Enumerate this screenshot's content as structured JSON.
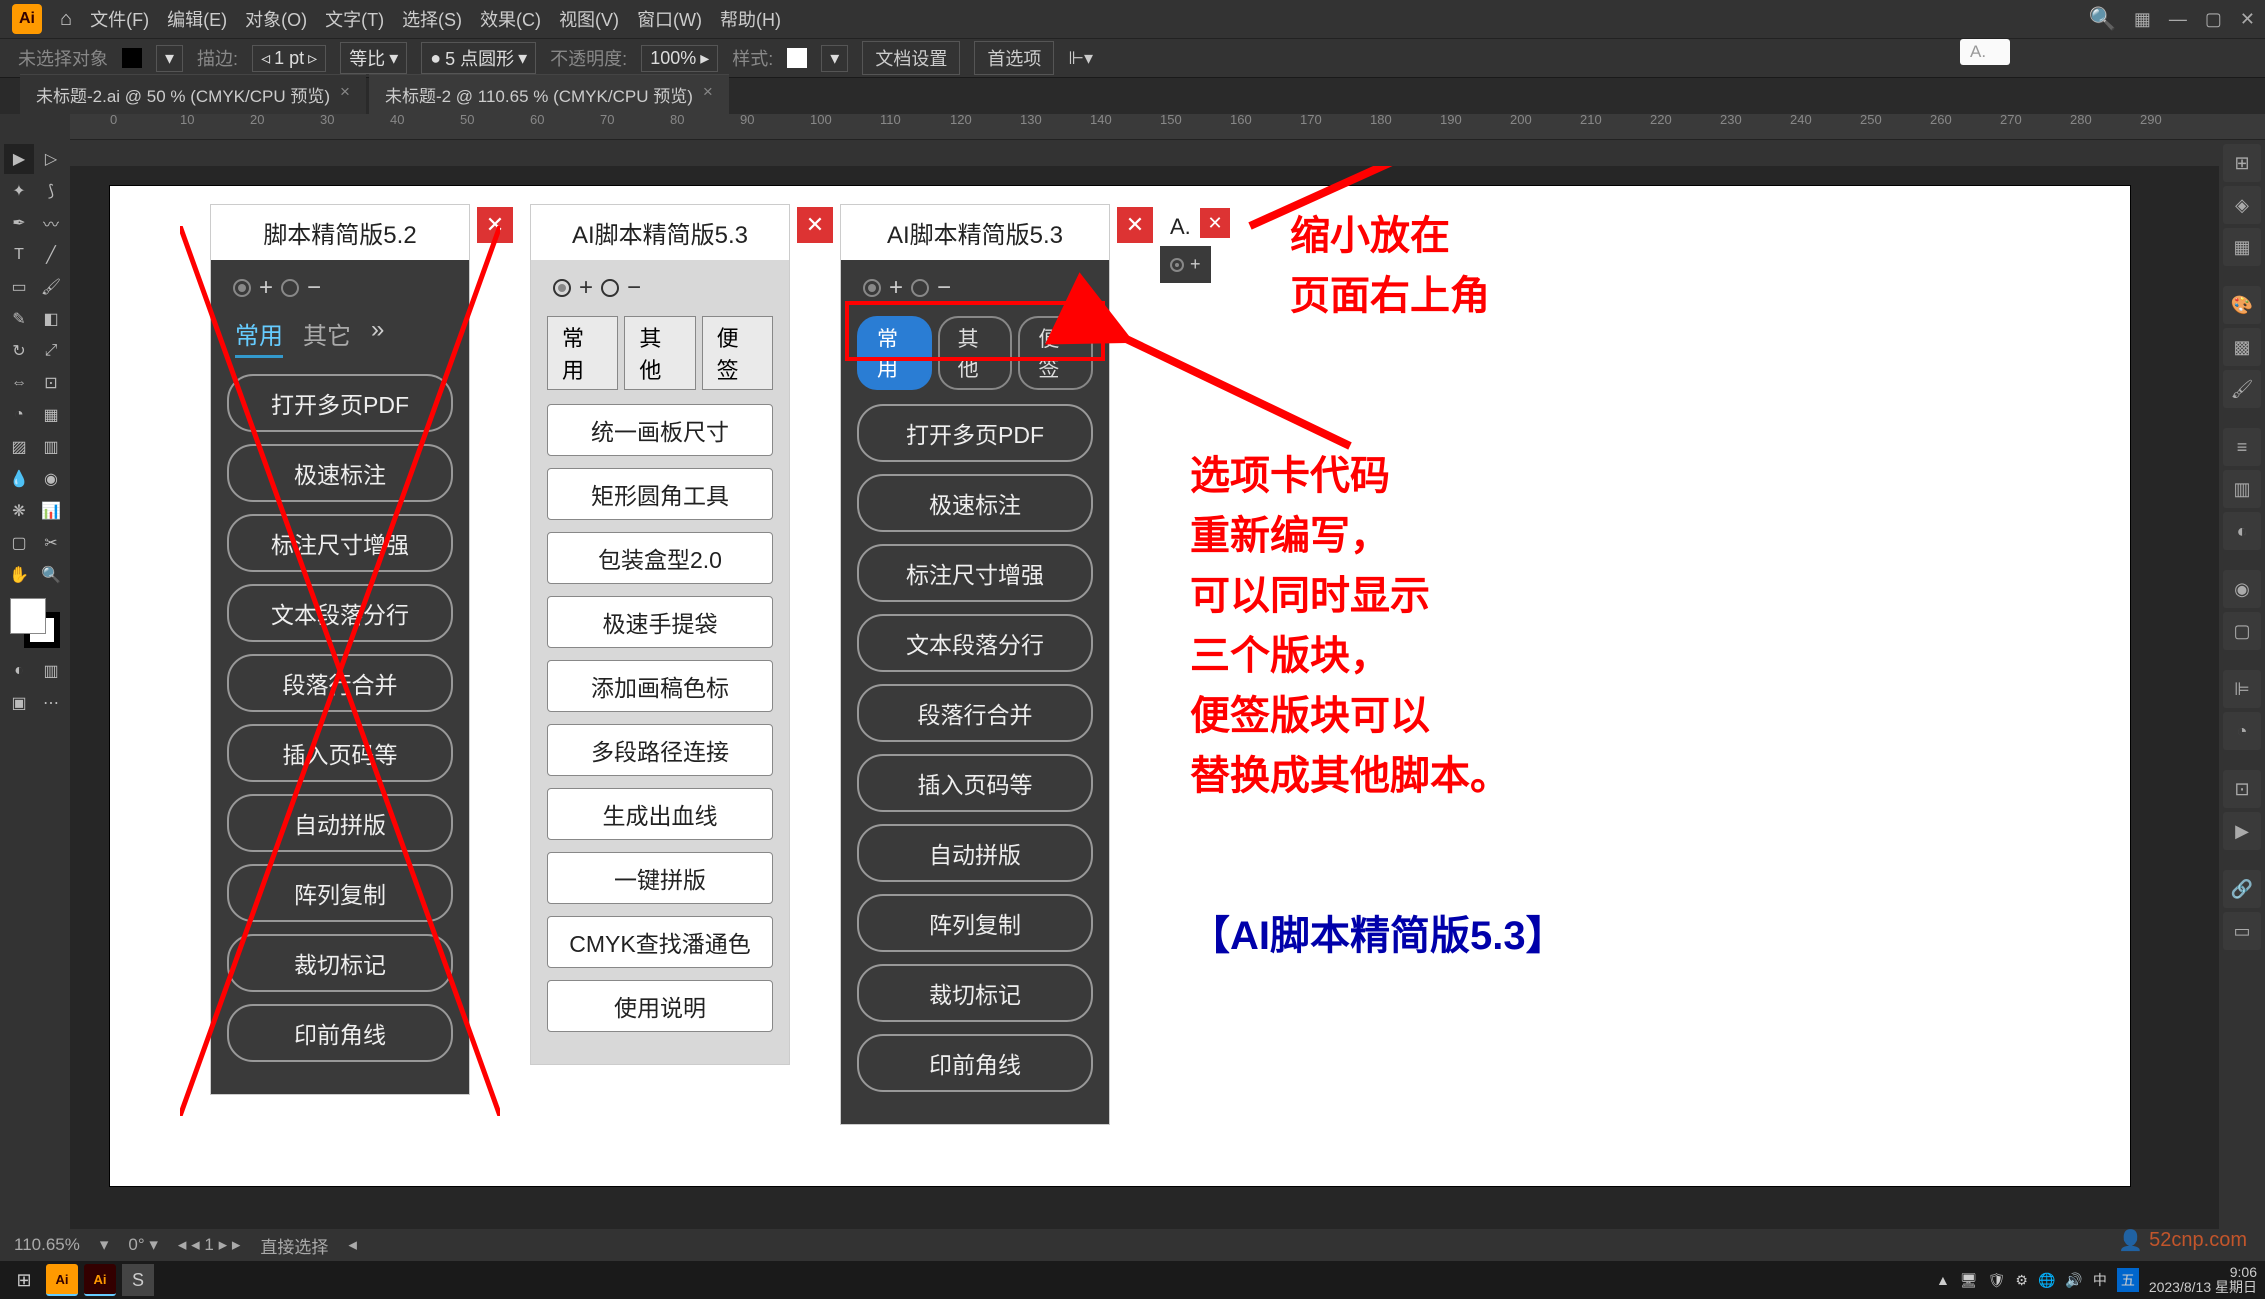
{
  "menubar": {
    "items": [
      "文件(F)",
      "编辑(E)",
      "对象(O)",
      "文字(T)",
      "选择(S)",
      "效果(C)",
      "视图(V)",
      "窗口(W)",
      "帮助(H)"
    ]
  },
  "search_placeholder": "A.",
  "options": {
    "no_selection": "未选择对象",
    "stroke_label": "描边:",
    "stroke_val": "1 pt",
    "uniform": "等比",
    "brush": "5 点圆形",
    "opacity_label": "不透明度:",
    "opacity_val": "100%",
    "style_label": "样式:",
    "doc_setup": "文档设置",
    "prefs": "首选项"
  },
  "tabs": [
    {
      "label": "未标题-2.ai @ 50 % (CMYK/CPU 预览)"
    },
    {
      "label": "未标题-2 @ 110.65 % (CMYK/CPU 预览)"
    }
  ],
  "ruler_marks": [
    0,
    10,
    20,
    30,
    40,
    50,
    60,
    70,
    80,
    90,
    100,
    110,
    120,
    130,
    140,
    150,
    160,
    170,
    180,
    190,
    200,
    210,
    220,
    230,
    240,
    250,
    260,
    270,
    280,
    290
  ],
  "panel52": {
    "title": "脚本精简版5.2",
    "tabs": [
      "常用",
      "其它"
    ],
    "buttons": [
      "打开多页PDF",
      "极速标注",
      "标注尺寸增强",
      "文本段落分行",
      "段落行合并",
      "插入页码等",
      "自动拼版",
      "阵列复制",
      "裁切标记",
      "印前角线"
    ]
  },
  "panel53_light": {
    "title": "AI脚本精简版5.3",
    "tabs": [
      "常用",
      "其他",
      "便签"
    ],
    "buttons": [
      "统一画板尺寸",
      "矩形圆角工具",
      "包装盒型2.0",
      "极速手提袋",
      "添加画稿色标",
      "多段路径连接",
      "生成出血线",
      "一键拼版",
      "CMYK查找潘通色",
      "使用说明"
    ]
  },
  "panel53_dark": {
    "title": "AI脚本精简版5.3",
    "tabs": [
      "常用",
      "其他",
      "便签"
    ],
    "buttons": [
      "打开多页PDF",
      "极速标注",
      "标注尺寸增强",
      "文本段落分行",
      "段落行合并",
      "插入页码等",
      "自动拼版",
      "阵列复制",
      "裁切标记",
      "印前角线"
    ]
  },
  "small_title": "A.",
  "annotations": {
    "top": "缩小放在\n页面右上角",
    "mid": "选项卡代码\n重新编写，\n可以同时显示\n三个版块，\n便签版块可以\n替换成其他脚本。",
    "bottom": "【AI脚本精简版5.3】"
  },
  "status": {
    "zoom": "110.65%",
    "tool": "直接选择"
  },
  "taskbar": {
    "time": "9:06",
    "date": "2023/8/13 星期日"
  },
  "watermark": "52cnp.com",
  "tray_text": "中"
}
